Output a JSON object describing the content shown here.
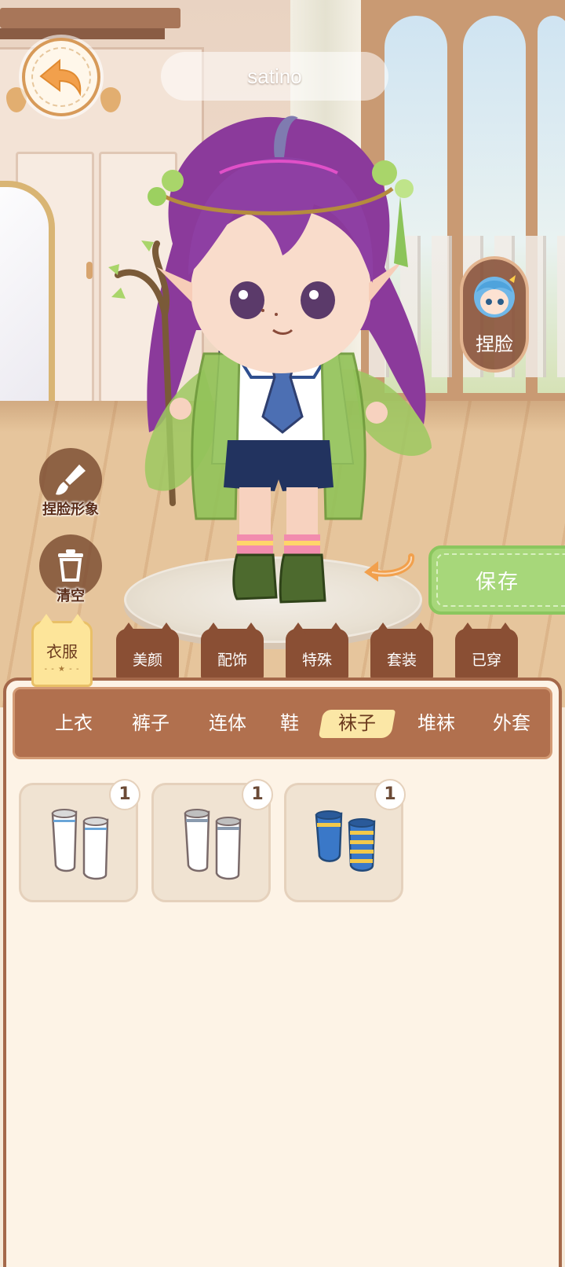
{
  "header": {
    "player_name": "satino"
  },
  "buttons": {
    "face_label": "捏脸",
    "pinch_face_label": "捏脸形象",
    "clear_label": "清空",
    "save_label": "保存"
  },
  "category_tabs": [
    {
      "label": "衣服",
      "active": true
    },
    {
      "label": "美颜"
    },
    {
      "label": "配饰"
    },
    {
      "label": "特殊"
    },
    {
      "label": "套装"
    },
    {
      "label": "已穿"
    }
  ],
  "sub_tabs": [
    {
      "label": "上衣"
    },
    {
      "label": "裤子"
    },
    {
      "label": "连体"
    },
    {
      "label": "鞋"
    },
    {
      "label": "袜子",
      "active": true
    },
    {
      "label": "堆袜"
    },
    {
      "label": "外套"
    }
  ],
  "items": [
    {
      "icon": "white-socks-blue-stripe-icon",
      "count": "1"
    },
    {
      "icon": "white-socks-gray-stripe-icon",
      "count": "1"
    },
    {
      "icon": "blue-yellow-striped-socks-icon",
      "count": "1"
    }
  ],
  "colors": {
    "panel_brown": "#a4684a",
    "subtab_brown": "#b1704e",
    "active_yellow": "#fde59a",
    "save_green": "#a7d77a",
    "back_orange": "#f2a04c"
  }
}
